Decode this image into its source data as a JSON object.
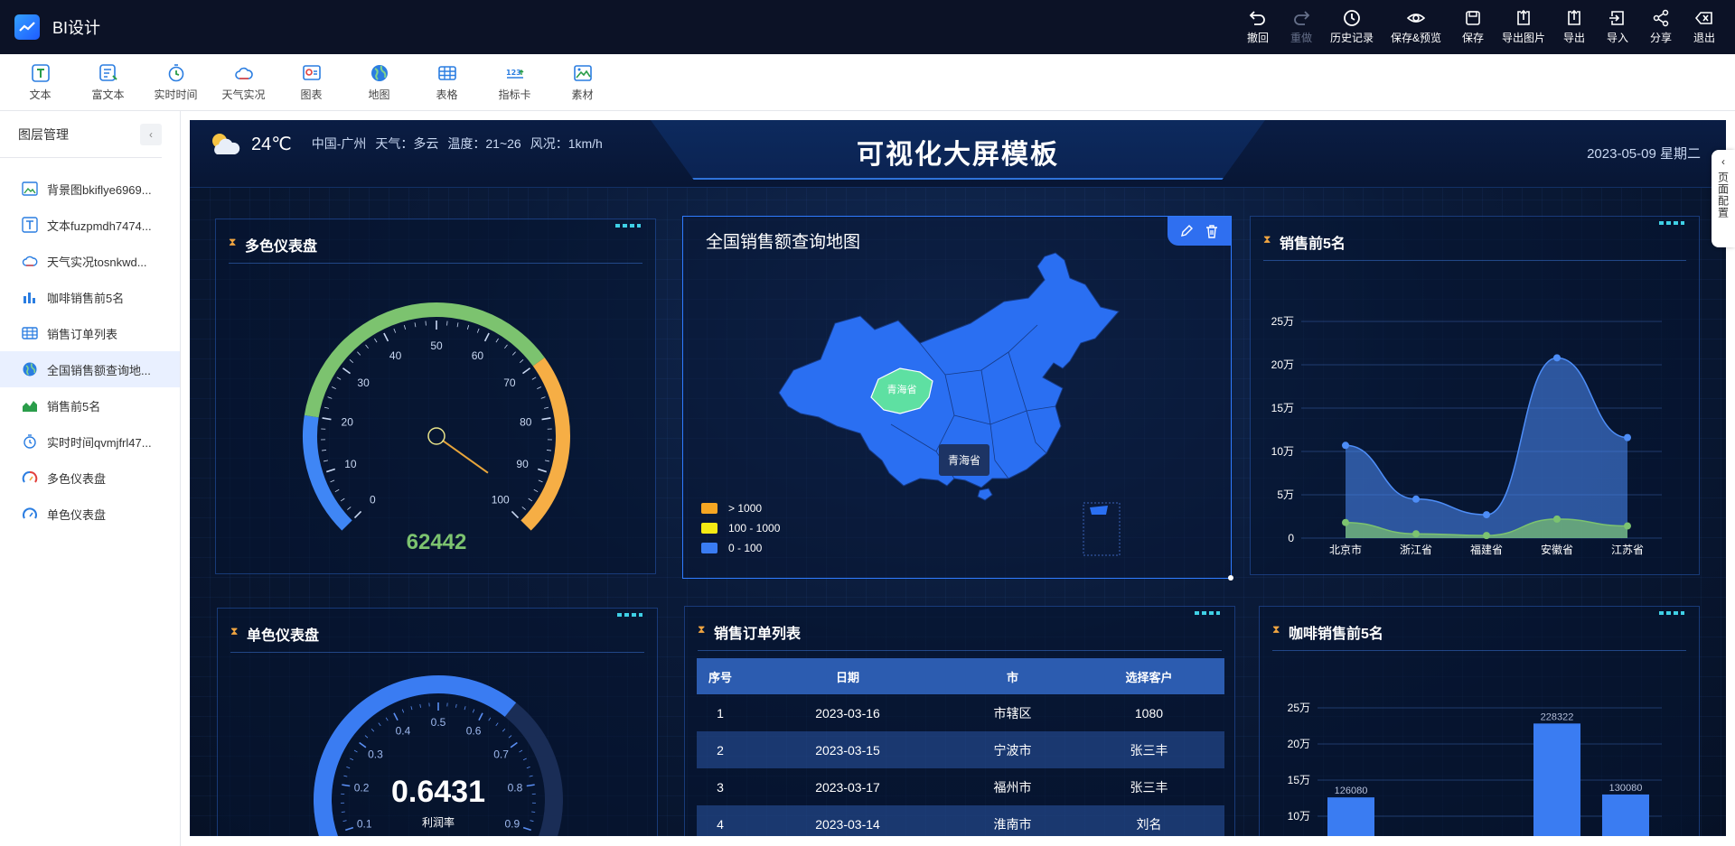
{
  "app": {
    "title": "BI设计"
  },
  "top_actions": [
    {
      "label": "撤回",
      "icon": "undo-icon"
    },
    {
      "label": "重做",
      "icon": "redo-icon",
      "disabled": true
    },
    {
      "label": "历史记录",
      "icon": "history-icon"
    },
    {
      "label": "保存&预览",
      "icon": "preview-icon"
    },
    {
      "label": "保存",
      "icon": "save-icon"
    },
    {
      "label": "导出图片",
      "icon": "export-image-icon"
    },
    {
      "label": "导出",
      "icon": "export-icon"
    },
    {
      "label": "导入",
      "icon": "import-icon"
    },
    {
      "label": "分享",
      "icon": "share-icon"
    },
    {
      "label": "退出",
      "icon": "exit-icon"
    }
  ],
  "toolbar": [
    {
      "label": "文本",
      "icon": "text-icon"
    },
    {
      "label": "富文本",
      "icon": "rich-text-icon"
    },
    {
      "label": "实时时间",
      "icon": "clock-icon"
    },
    {
      "label": "天气实况",
      "icon": "weather-icon"
    },
    {
      "label": "图表",
      "icon": "chart-icon"
    },
    {
      "label": "地图",
      "icon": "globe-icon"
    },
    {
      "label": "表格",
      "icon": "table-icon"
    },
    {
      "label": "指标卡",
      "icon": "indicator-card-icon"
    },
    {
      "label": "素材",
      "icon": "material-icon"
    }
  ],
  "sidebar": {
    "title": "图层管理",
    "collapse_symbol": "‹",
    "layers": [
      {
        "label": "背景图bkiflye6969...",
        "icon": "image-icon"
      },
      {
        "label": "文本fuzpmdh7474...",
        "icon": "text-icon"
      },
      {
        "label": "天气实况tosnkwd...",
        "icon": "weather-icon"
      },
      {
        "label": "咖啡销售前5名",
        "icon": "bar-chart-icon"
      },
      {
        "label": "销售订单列表",
        "icon": "table-icon"
      },
      {
        "label": "全国销售额查询地...",
        "icon": "globe-icon",
        "active": true
      },
      {
        "label": "销售前5名",
        "icon": "area-chart-icon"
      },
      {
        "label": "实时时间qvmjfrl47...",
        "icon": "clock-icon"
      },
      {
        "label": "多色仪表盘",
        "icon": "gauge-icon"
      },
      {
        "label": "单色仪表盘",
        "icon": "gauge-icon"
      }
    ]
  },
  "right_tab": {
    "label": "页面配置",
    "arrow": "‹"
  },
  "dashboard": {
    "title": "可视化大屏模板",
    "date": "2023-05-09 星期二",
    "weather": {
      "temp": "24℃",
      "city": "中国-广州",
      "weather": "天气：多云",
      "range": "温度：21~26",
      "wind": "风况：1km/h"
    },
    "multi_gauge": {
      "title": "多色仪表盘",
      "value": 62442,
      "value_text": "62442",
      "ticks": [
        "0",
        "10",
        "20",
        "30",
        "40",
        "50",
        "60",
        "70",
        "80",
        "90",
        "100"
      ],
      "needle_value": 96.5,
      "colors": [
        "#3f86f5",
        "#7cc36f",
        "#f6ae45"
      ]
    },
    "map": {
      "title": "全国销售额查询地图",
      "highlight_label": "青海省",
      "tooltip": "青海省",
      "legend": [
        {
          "label": "> 1000",
          "color": "#f5a623"
        },
        {
          "label": "100 - 1000",
          "color": "#f5ea14"
        },
        {
          "label": "0 - 100",
          "color": "#3a7cf2"
        }
      ]
    },
    "sales_top5": {
      "title": "销售前5名",
      "chart_data": {
        "type": "area",
        "categories": [
          "北京市",
          "浙江省",
          "福建省",
          "安徽省",
          "江苏省"
        ],
        "ylim": [
          0,
          250000
        ],
        "yticks": [
          "0",
          "5万",
          "10万",
          "15万",
          "20万",
          "25万"
        ],
        "series": [
          {
            "values": [
              107000,
              45000,
              27000,
              208000,
              116000
            ],
            "color": "#4d8df7"
          },
          {
            "values": [
              18000,
              5000,
              3000,
              22000,
              14000
            ],
            "color": "#7cc36f"
          }
        ]
      }
    },
    "single_gauge": {
      "title": "单色仪表盘",
      "value_text": "0.6431",
      "value": 0.6431,
      "label": "利润率",
      "ticks": [
        "0.1",
        "0.2",
        "0.3",
        "0.4",
        "0.5",
        "0.6",
        "0.7",
        "0.8",
        "0.9"
      ]
    },
    "orders": {
      "title": "销售订单列表",
      "columns": [
        "序号",
        "日期",
        "市",
        "选择客户"
      ],
      "rows": [
        [
          "1",
          "2023-03-16",
          "市辖区",
          "1080"
        ],
        [
          "2",
          "2023-03-15",
          "宁波市",
          "张三丰"
        ],
        [
          "3",
          "2023-03-17",
          "福州市",
          "张三丰"
        ],
        [
          "4",
          "2023-03-14",
          "淮南市",
          "刘名"
        ]
      ]
    },
    "coffee_top5": {
      "title": "咖啡销售前5名",
      "chart_data": {
        "type": "bar",
        "yticks": [
          "10万",
          "15万",
          "20万",
          "25万"
        ],
        "ylim": [
          100000,
          250000
        ],
        "visible_bars": [
          {
            "label": "126080",
            "value": 126080,
            "slot": 0
          },
          {
            "label": "228322",
            "value": 228322,
            "slot": 3
          },
          {
            "label": "130080",
            "value": 130080,
            "slot": 4
          }
        ],
        "color": "#3a7cf2"
      }
    }
  }
}
